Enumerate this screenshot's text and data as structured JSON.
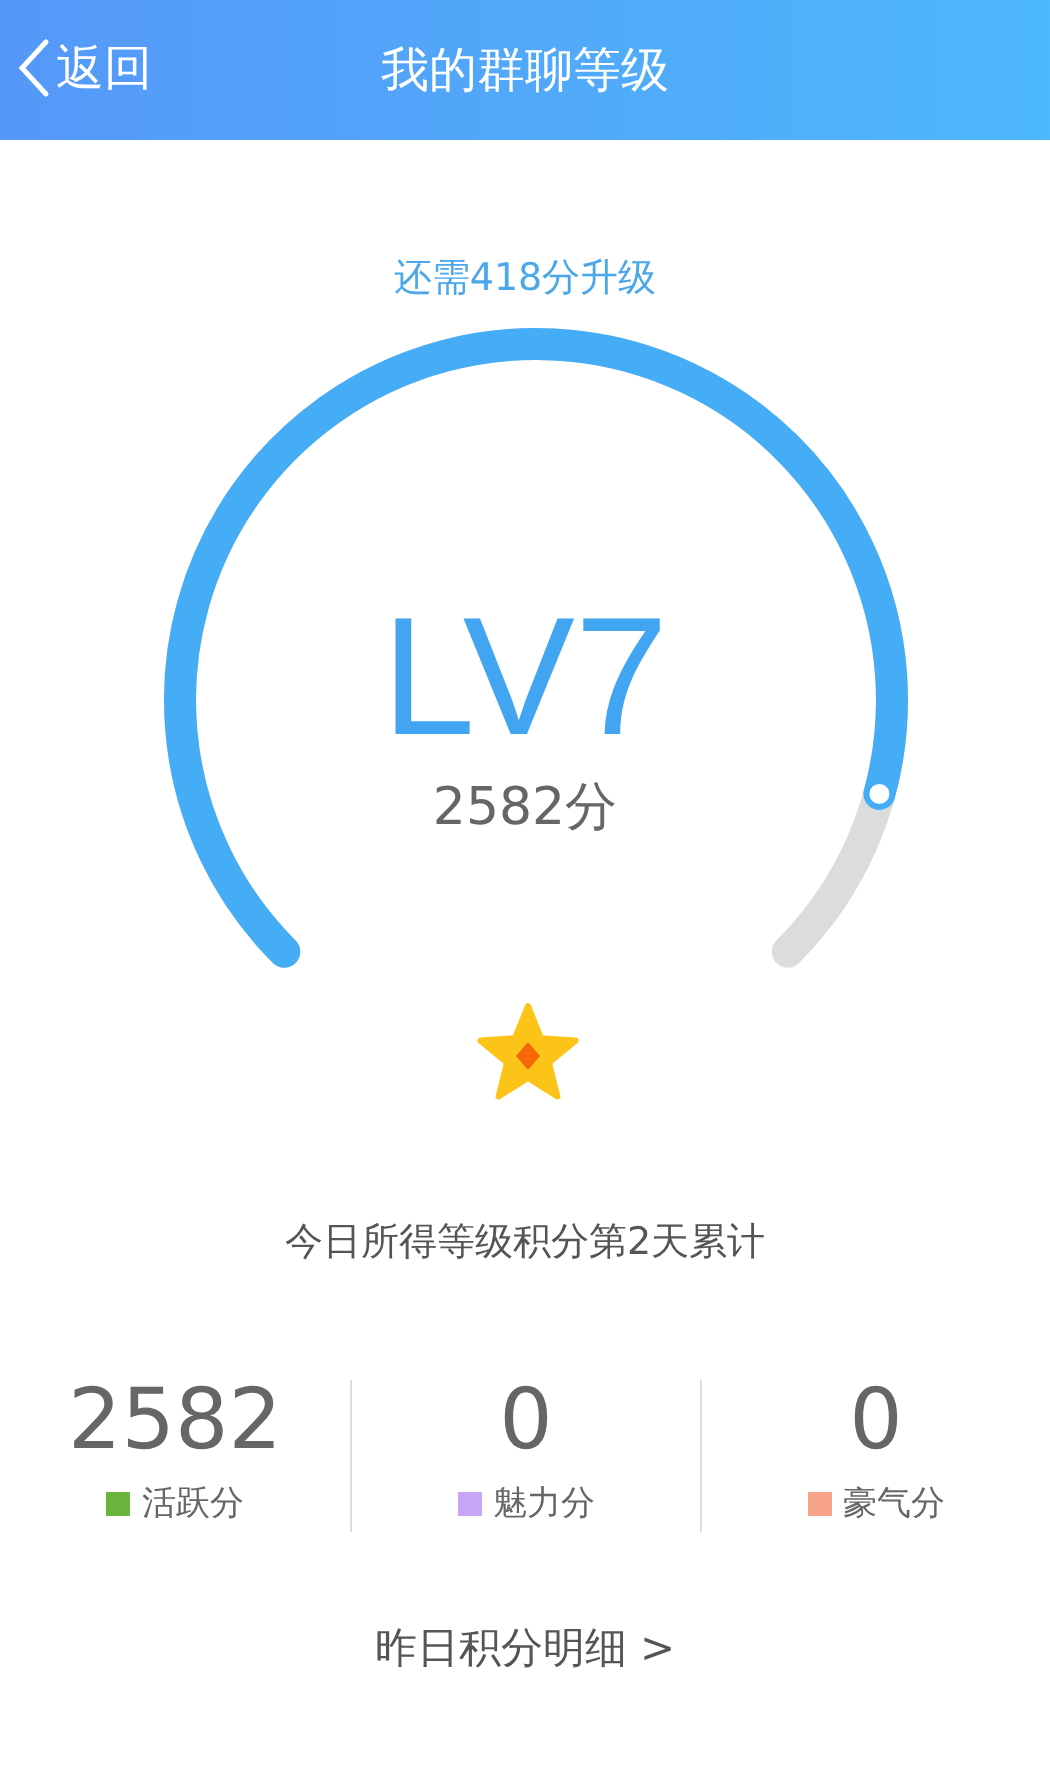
{
  "header": {
    "back": "返回",
    "title": "我的群聊等级"
  },
  "upgrade_hint": "还需418分升级",
  "gauge": {
    "grade": "LV7",
    "points": "2582分"
  },
  "caption": "今日所得等级积分第2天累计",
  "stats": [
    {
      "value": "2582",
      "label": "活跃分",
      "color": "#6ab43c"
    },
    {
      "value": "0",
      "label": "魅力分",
      "color": "#c7a6fa"
    },
    {
      "value": "0",
      "label": "豪气分",
      "color": "#f7a48a"
    }
  ],
  "detail_link": "昨日积分明细 >"
}
